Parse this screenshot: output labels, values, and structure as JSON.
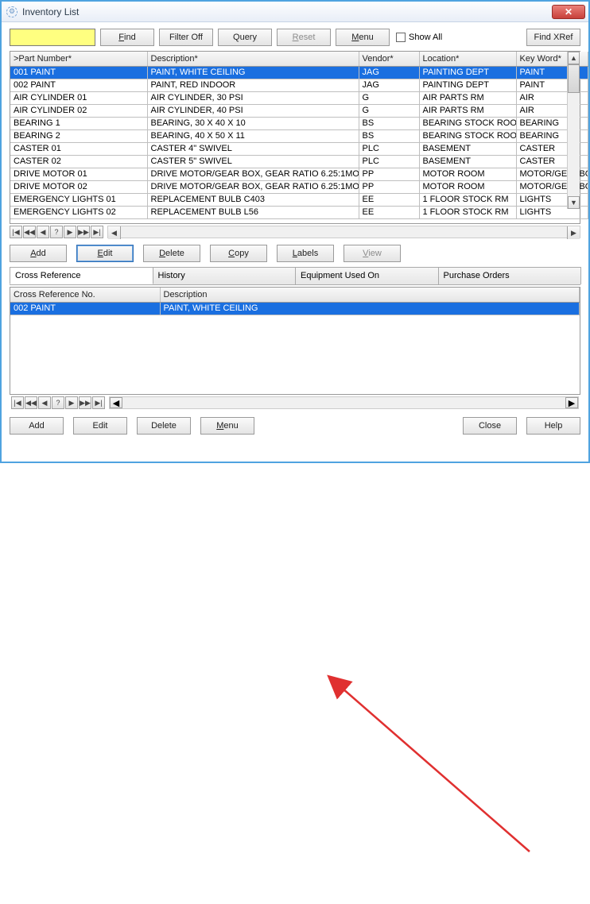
{
  "window": {
    "title": "Inventory List"
  },
  "toolbar": {
    "search_value": "",
    "find": "Find",
    "filter_off": "Filter Off",
    "query": "Query",
    "reset": "Reset",
    "menu": "Menu",
    "show_all": "Show All",
    "find_xref": "Find XRef"
  },
  "columns": {
    "c0": ">Part Number*",
    "c1": "Description*",
    "c2": "Vendor*",
    "c3": "Location*",
    "c4": "Key Word*"
  },
  "rows": [
    {
      "pn": "001 PAINT",
      "desc": "PAINT, WHITE CEILING",
      "vendor": "JAG",
      "loc": "PAINTING DEPT",
      "kw": "PAINT",
      "selected": true
    },
    {
      "pn": "002 PAINT",
      "desc": "PAINT, RED INDOOR",
      "vendor": "JAG",
      "loc": "PAINTING DEPT",
      "kw": "PAINT"
    },
    {
      "pn": "AIR CYLINDER 01",
      "desc": "AIR CYLINDER, 30 PSI",
      "vendor": "G",
      "loc": "AIR PARTS RM",
      "kw": "AIR"
    },
    {
      "pn": "AIR CYLINDER 02",
      "desc": "AIR CYLINDER, 40 PSI",
      "vendor": "G",
      "loc": "AIR PARTS RM",
      "kw": "AIR"
    },
    {
      "pn": "BEARING 1",
      "desc": "BEARING, 30 X 40 X 10",
      "vendor": "BS",
      "loc": "BEARING STOCK ROOM",
      "kw": "BEARING"
    },
    {
      "pn": "BEARING 2",
      "desc": "BEARING, 40 X 50 X 11",
      "vendor": "BS",
      "loc": "BEARING STOCK ROOM",
      "kw": "BEARING"
    },
    {
      "pn": "CASTER 01",
      "desc": "CASTER 4\" SWIVEL",
      "vendor": "PLC",
      "loc": "BASEMENT",
      "kw": "CASTER"
    },
    {
      "pn": "CASTER 02",
      "desc": "CASTER 5\" SWIVEL",
      "vendor": "PLC",
      "loc": "BASEMENT",
      "kw": "CASTER"
    },
    {
      "pn": "DRIVE MOTOR 01",
      "desc": "DRIVE MOTOR/GEAR BOX, GEAR RATIO 6.25:1MO",
      "vendor": "PP",
      "loc": "MOTOR ROOM",
      "kw": "MOTOR/GEARBOX"
    },
    {
      "pn": "DRIVE MOTOR 02",
      "desc": "DRIVE MOTOR/GEAR BOX, GEAR RATIO 6.25:1MO",
      "vendor": "PP",
      "loc": "MOTOR ROOM",
      "kw": "MOTOR/GEARBOX"
    },
    {
      "pn": "EMERGENCY LIGHTS 01",
      "desc": "REPLACEMENT BULB C403",
      "vendor": "EE",
      "loc": "1 FLOOR STOCK RM",
      "kw": "LIGHTS"
    },
    {
      "pn": "EMERGENCY LIGHTS 02",
      "desc": "REPLACEMENT BULB L56",
      "vendor": "EE",
      "loc": "1 FLOOR STOCK RM",
      "kw": "LIGHTS"
    }
  ],
  "actions": {
    "add": "Add",
    "edit": "Edit",
    "delete": "Delete",
    "copy": "Copy",
    "labels": "Labels",
    "view": "View"
  },
  "tabs": {
    "t0": "Cross Reference",
    "t1": "History",
    "t2": "Equipment Used On",
    "t3": "Purchase Orders"
  },
  "detail": {
    "col0": "Cross Reference No.",
    "col1": "Description",
    "rows": [
      {
        "no": "002 PAINT",
        "desc": "PAINT, WHITE CEILING",
        "selected": true
      }
    ]
  },
  "footer": {
    "add": "Add",
    "edit": "Edit",
    "delete": "Delete",
    "menu": "Menu",
    "close": "Close",
    "help": "Help"
  }
}
